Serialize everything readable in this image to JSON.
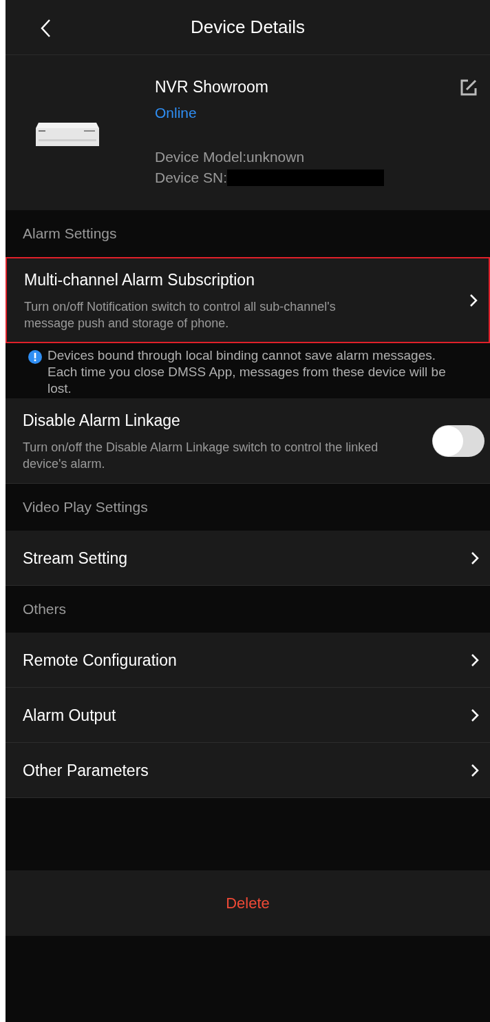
{
  "header": {
    "title": "Device Details"
  },
  "device": {
    "name": "NVR Showroom",
    "status": "Online",
    "model": "Device Model:unknown",
    "sn_label": "Device SN:",
    "sn_redacted": true
  },
  "list": [
    {
      "kind": "section",
      "label": "Alarm Settings"
    },
    {
      "kind": "nav",
      "label": "Multi-channel Alarm Subscription",
      "description": "Turn on/off Notification switch to control all sub-channel's message push and storage of phone.",
      "highlighted": true
    },
    {
      "kind": "notice",
      "text": "Devices bound through local binding cannot save alarm messages. Each time you close DMSS App, messages from these device will be lost."
    },
    {
      "kind": "toggle",
      "label": "Disable Alarm Linkage",
      "description": "Turn on/off the Disable Alarm Linkage switch to control the linked device's alarm.",
      "on": false
    },
    {
      "kind": "section",
      "label": "Video Play Settings"
    },
    {
      "kind": "nav",
      "label": "Stream Setting",
      "highlighted": false
    },
    {
      "kind": "section",
      "label": "Others"
    },
    {
      "kind": "nav",
      "label": "Remote Configuration",
      "highlighted": false
    },
    {
      "kind": "nav",
      "label": "Alarm Output",
      "highlighted": false
    },
    {
      "kind": "nav",
      "label": "Other Parameters",
      "highlighted": false
    }
  ],
  "delete_button": "Delete"
}
